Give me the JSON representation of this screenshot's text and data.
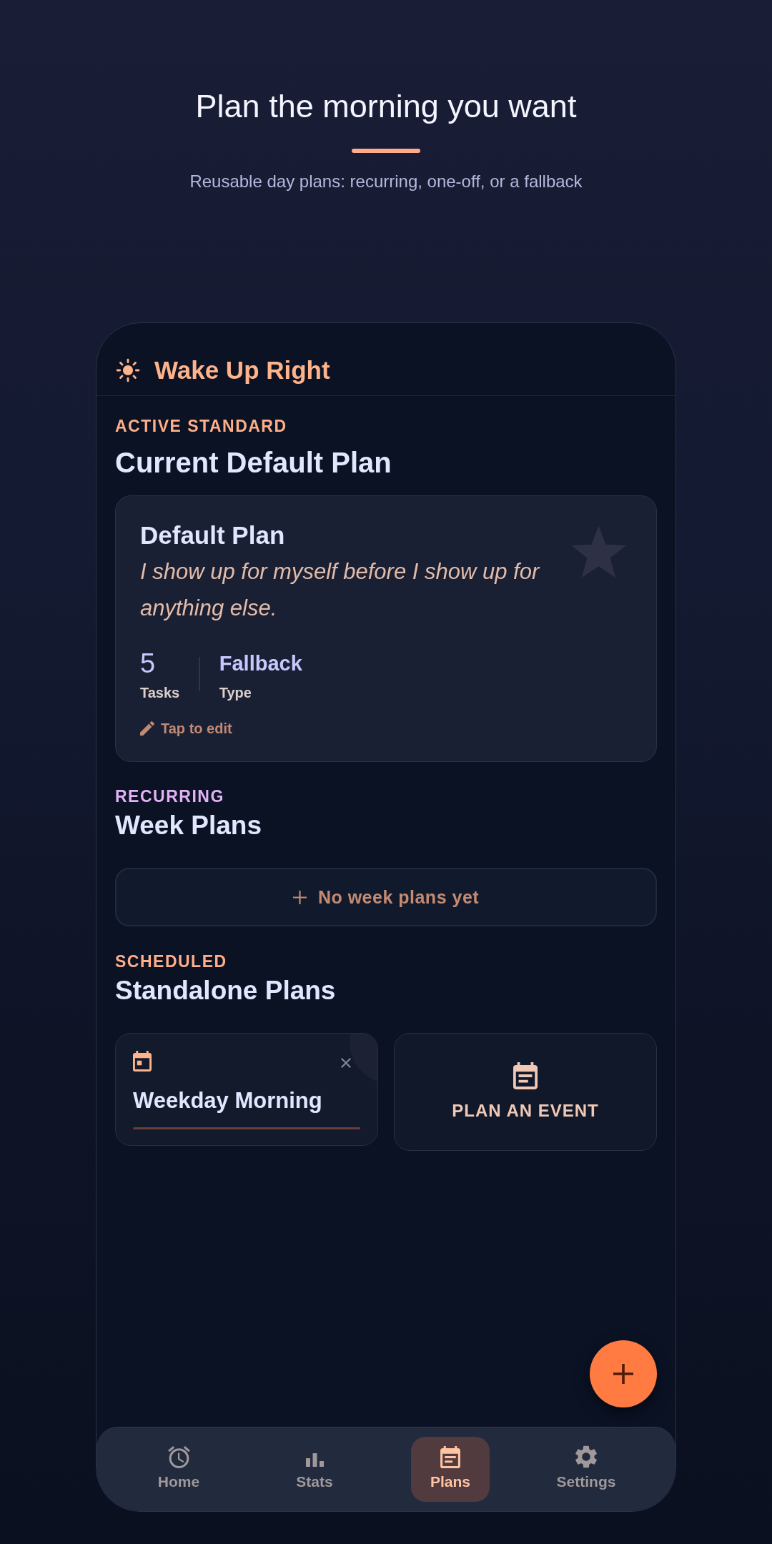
{
  "intro": {
    "title": "Plan the morning you want",
    "subtitle": "Reusable day plans: recurring, one-off, or a fallback"
  },
  "app_bar": {
    "title": "Wake Up Right"
  },
  "default_section": {
    "label": "ACTIVE STANDARD",
    "heading": "Current Default Plan",
    "plan": {
      "name": "Default Plan",
      "quote": "I show up for myself before I show up for anything else.",
      "stats": [
        {
          "kind": "number",
          "value": "5",
          "label": "Tasks"
        },
        {
          "kind": "text",
          "value": "Fallback",
          "label": "Type"
        }
      ],
      "edit_hint": "Tap to edit"
    }
  },
  "week_section": {
    "label": "RECURRING",
    "heading": "Week Plans",
    "empty_action": "No week plans yet"
  },
  "standalone_section": {
    "label": "SCHEDULED",
    "heading": "Standalone Plans",
    "plans": [
      {
        "name": "Weekday Morning"
      }
    ],
    "new_event": "PLAN AN EVENT"
  },
  "bottom_nav": [
    {
      "kind": "home",
      "label": "Home",
      "selected": false
    },
    {
      "kind": "stats",
      "label": "Stats",
      "selected": false
    },
    {
      "kind": "plans",
      "label": "Plans",
      "selected": true
    },
    {
      "kind": "settings",
      "label": "Settings",
      "selected": false
    }
  ]
}
